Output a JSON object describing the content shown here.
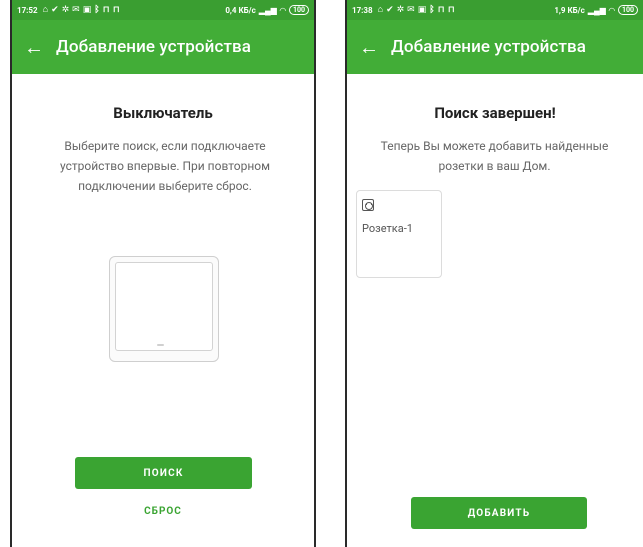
{
  "left": {
    "status": {
      "time": "17:52",
      "net_speed": "0,4 КБ/с",
      "battery": "100"
    },
    "appbar": {
      "back_glyph": "←",
      "title": "Добавление устройства"
    },
    "device_title": "Выключатель",
    "description": "Выберите поиск, если подключаете устройство впервые. При повторном подключении выберите сброс.",
    "search_label": "ПОИСК",
    "reset_label": "СБРОС"
  },
  "right": {
    "status": {
      "time": "17:38",
      "net_speed": "1,9 КБ/с",
      "battery": "100"
    },
    "appbar": {
      "back_glyph": "←",
      "title": "Добавление устройства"
    },
    "done_title": "Поиск завершен!",
    "description": "Теперь Вы можете добавить найденные розетки в ваш Дом.",
    "found_devices": [
      {
        "name": "Розетка-1",
        "icon": "socket-icon"
      }
    ],
    "add_label": "ДОБАВИТЬ"
  },
  "colors": {
    "statusbar": "#3a9e31",
    "appbar": "#42ad37",
    "accent": "#3aa432"
  }
}
